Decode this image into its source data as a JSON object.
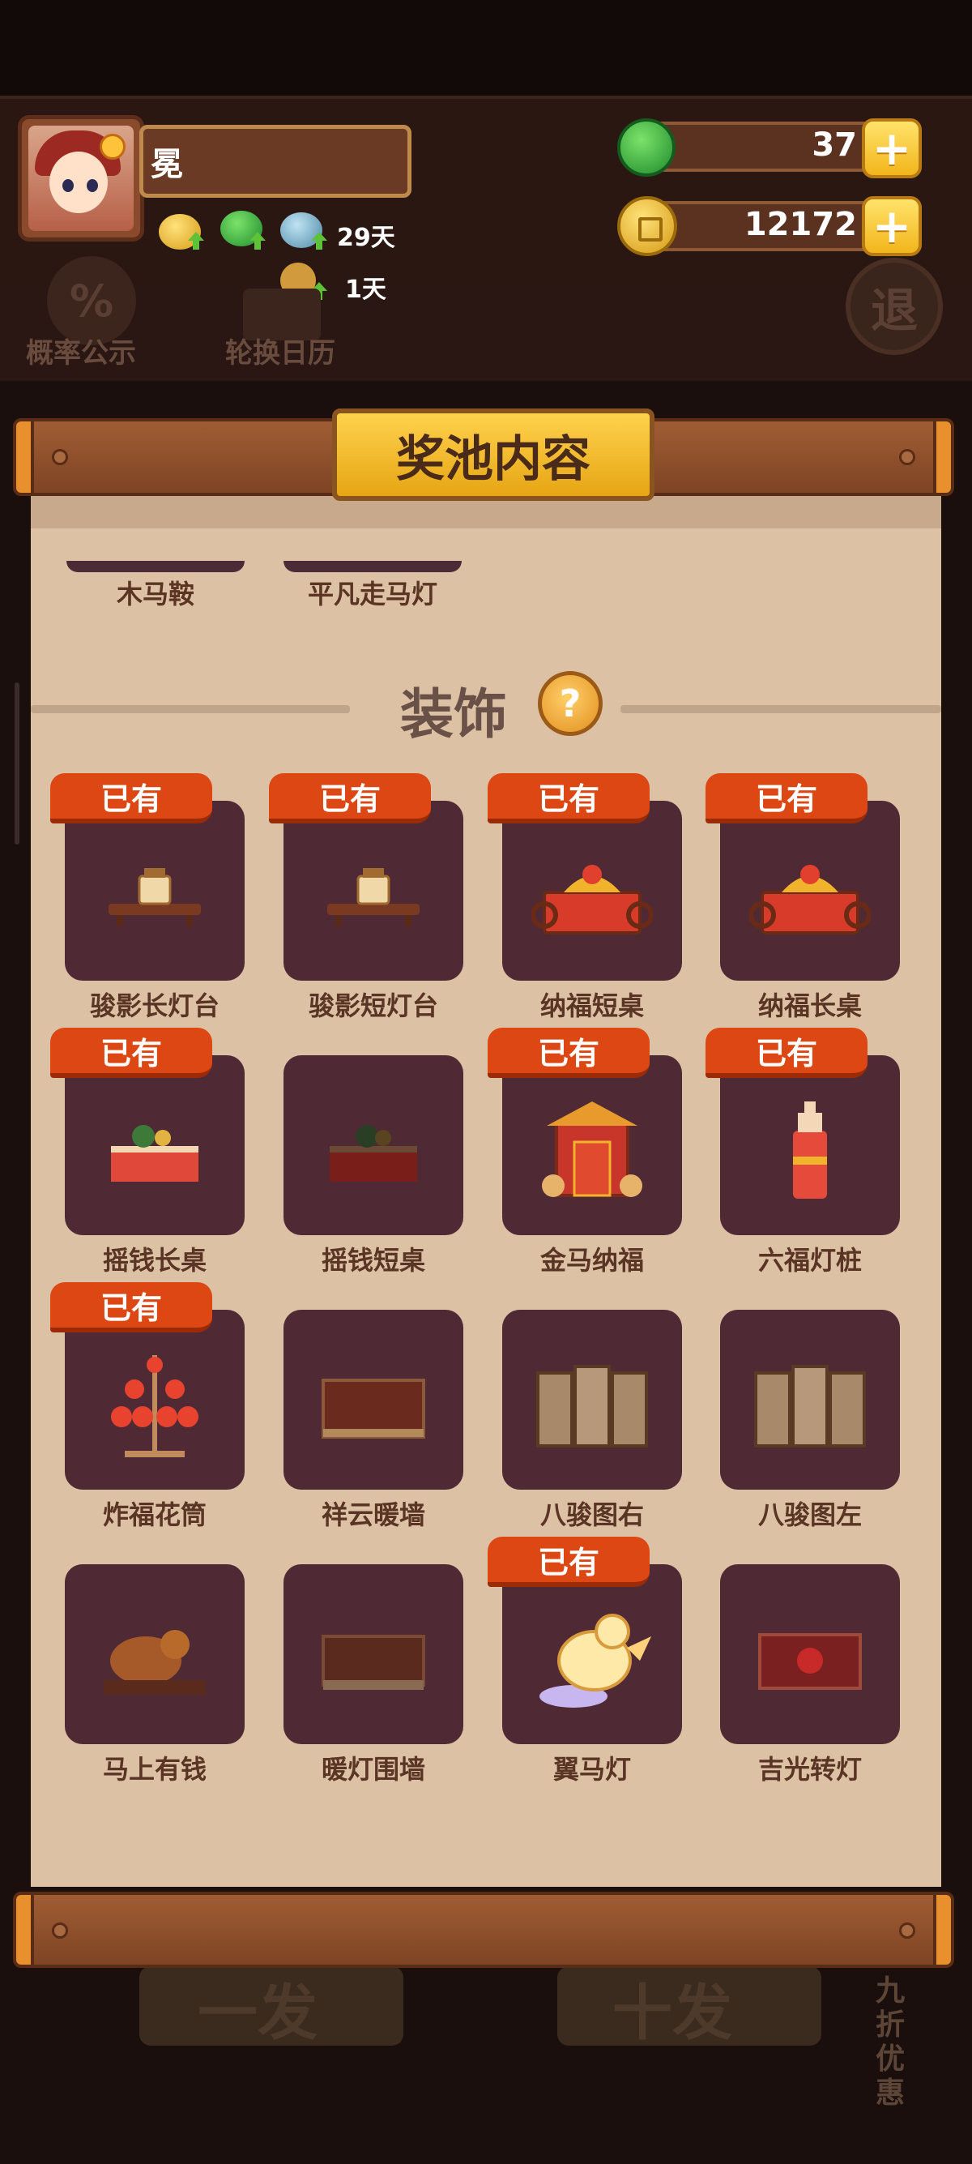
{
  "player": {
    "name": "冕"
  },
  "boosts": [
    {
      "icon": "coin-boost-icon",
      "label": ""
    },
    {
      "icon": "jade-boost-icon",
      "label": ""
    },
    {
      "icon": "bowl-boost-icon",
      "label": "29天"
    },
    {
      "icon": "key-boost-icon",
      "label": "1天"
    }
  ],
  "currency": {
    "jade": {
      "value": "37",
      "icon": "jade-icon"
    },
    "coins": {
      "value": "12172",
      "icon": "coin-icon"
    }
  },
  "background_menu": {
    "probability": "概率公示",
    "calendar": "轮换日历",
    "exit": "退",
    "single_draw": "一发",
    "ten_draw": "十发",
    "discount": "九折优惠"
  },
  "dialog": {
    "title": "奖池内容",
    "previous_items": [
      "木马鞍",
      "平凡走马灯"
    ],
    "section_title": "装饰",
    "owned_label": "已有",
    "items": [
      {
        "name": "骏影长灯台",
        "owned": true,
        "art": "lamp-stand"
      },
      {
        "name": "骏影短灯台",
        "owned": true,
        "art": "lamp-stand"
      },
      {
        "name": "纳福短桌",
        "owned": true,
        "art": "fortune-table"
      },
      {
        "name": "纳福长桌",
        "owned": true,
        "art": "fortune-table"
      },
      {
        "name": "摇钱长桌",
        "owned": true,
        "art": "money-table"
      },
      {
        "name": "摇钱短桌",
        "owned": false,
        "art": "money-table-dark"
      },
      {
        "name": "金马纳福",
        "owned": true,
        "art": "gate"
      },
      {
        "name": "六福灯桩",
        "owned": true,
        "art": "lantern-post"
      },
      {
        "name": "炸福花筒",
        "owned": true,
        "art": "lantern-tree"
      },
      {
        "name": "祥云暖墙",
        "owned": false,
        "art": "wall"
      },
      {
        "name": "八骏图右",
        "owned": false,
        "art": "screen"
      },
      {
        "name": "八骏图左",
        "owned": false,
        "art": "screen"
      },
      {
        "name": "马上有钱",
        "owned": false,
        "art": "horse-cart"
      },
      {
        "name": "暖灯围墙",
        "owned": false,
        "art": "lamp-wall"
      },
      {
        "name": "翼马灯",
        "owned": true,
        "art": "winged-horse"
      },
      {
        "name": "吉光转灯",
        "owned": false,
        "art": "rotating-lamp"
      }
    ]
  },
  "colors": {
    "panel": "#dcc1a4",
    "card": "#4f2a35",
    "badge": "#dc4713",
    "wood": "#8a4a28",
    "title_plate": "#f2bc2c"
  }
}
